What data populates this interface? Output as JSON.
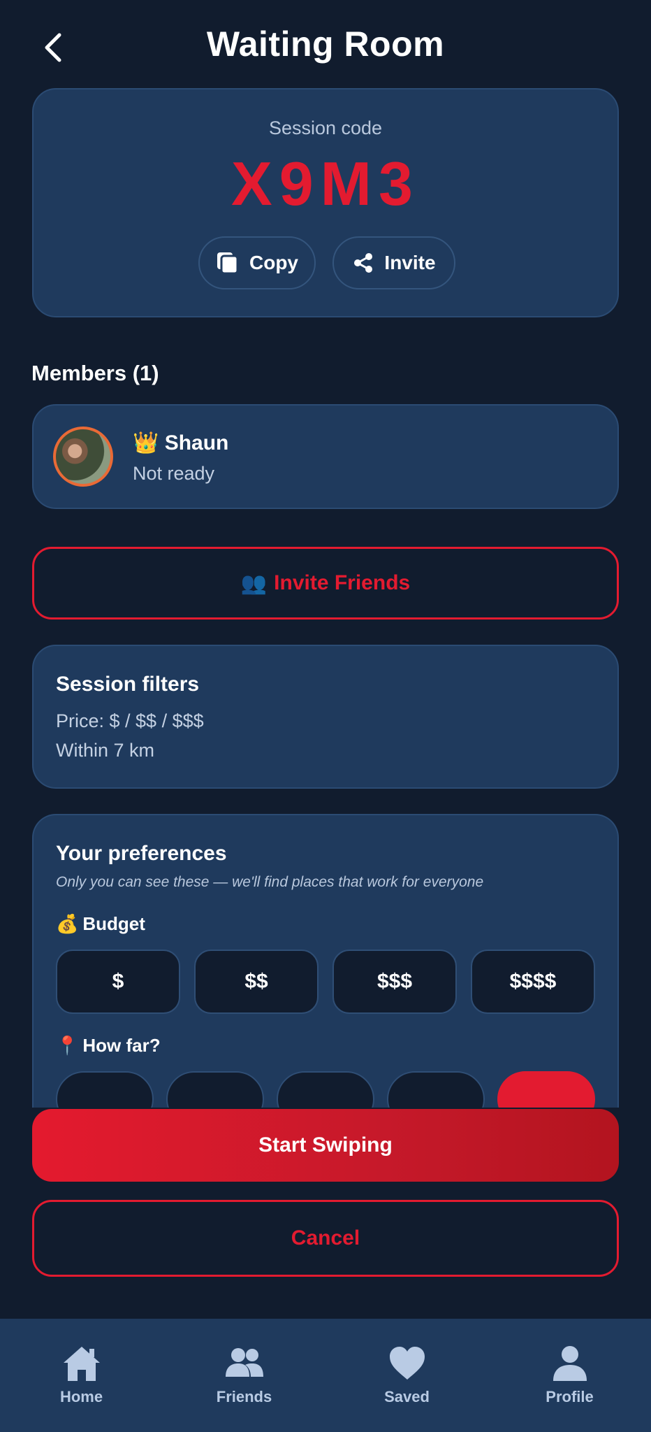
{
  "header": {
    "title": "Waiting Room"
  },
  "session": {
    "label": "Session code",
    "code": "X9M3",
    "copy_label": "Copy",
    "invite_label": "Invite"
  },
  "members": {
    "title": "Members (1)",
    "items": [
      {
        "crown": "👑",
        "name": "Shaun",
        "status": "Not ready"
      }
    ]
  },
  "invite_friends": {
    "emoji": "👥",
    "label": "Invite Friends"
  },
  "filters": {
    "title": "Session filters",
    "price": "Price: $ / $$ / $$$",
    "distance": "Within 7 km"
  },
  "preferences": {
    "title": "Your preferences",
    "subtitle": "Only you can see these — we'll find places that work for everyone",
    "budget_emoji": "💰",
    "budget_label": "Budget",
    "budget_options": [
      "$",
      "$$",
      "$$$",
      "$$$$"
    ],
    "distance_emoji": "📍",
    "distance_label": "How far?"
  },
  "actions": {
    "start": "Start Swiping",
    "cancel": "Cancel"
  },
  "tabs": [
    {
      "label": "Home",
      "icon": "home-icon"
    },
    {
      "label": "Friends",
      "icon": "friends-icon"
    },
    {
      "label": "Saved",
      "icon": "heart-icon"
    },
    {
      "label": "Profile",
      "icon": "profile-icon"
    }
  ],
  "colors": {
    "background": "#111c2e",
    "card": "#1f3a5d",
    "accent": "#e31b30",
    "tab_icon": "#b9cbe4"
  }
}
